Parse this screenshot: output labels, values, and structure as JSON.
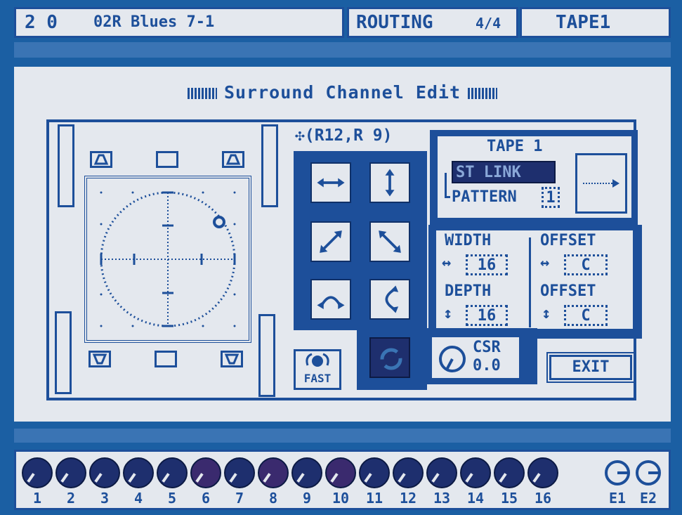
{
  "header": {
    "scene_number": "2 0",
    "scene_name": "02R Blues 7-1",
    "screen_name": "ROUTING",
    "page": "4/4",
    "channel": "TAPE1"
  },
  "panel": {
    "title": "Surround Channel Edit",
    "coordinates": "(R12,R 9)"
  },
  "link_box": {
    "channel": "TAPE 1",
    "st_link": "ST LINK",
    "pattern_label": "PATTERN",
    "pattern_value": "1"
  },
  "params": {
    "width_label": "WIDTH",
    "width_value": "16",
    "depth_label": "DEPTH",
    "depth_value": "16",
    "offset_h_label": "OFFSET",
    "offset_h_value": "C",
    "offset_v_label": "OFFSET",
    "offset_v_value": "C"
  },
  "fast_label": "FAST",
  "csr": {
    "label": "CSR",
    "value": "0.0"
  },
  "exit_label": "EXIT",
  "channels": [
    "1",
    "2",
    "3",
    "4",
    "5",
    "6",
    "7",
    "8",
    "9",
    "10",
    "11",
    "12",
    "13",
    "14",
    "15",
    "16"
  ],
  "effects": [
    "E1",
    "E2"
  ],
  "colors": {
    "background": "#1b5fa3",
    "panel": "#e4e8ee",
    "ink": "#1d4f9a"
  }
}
